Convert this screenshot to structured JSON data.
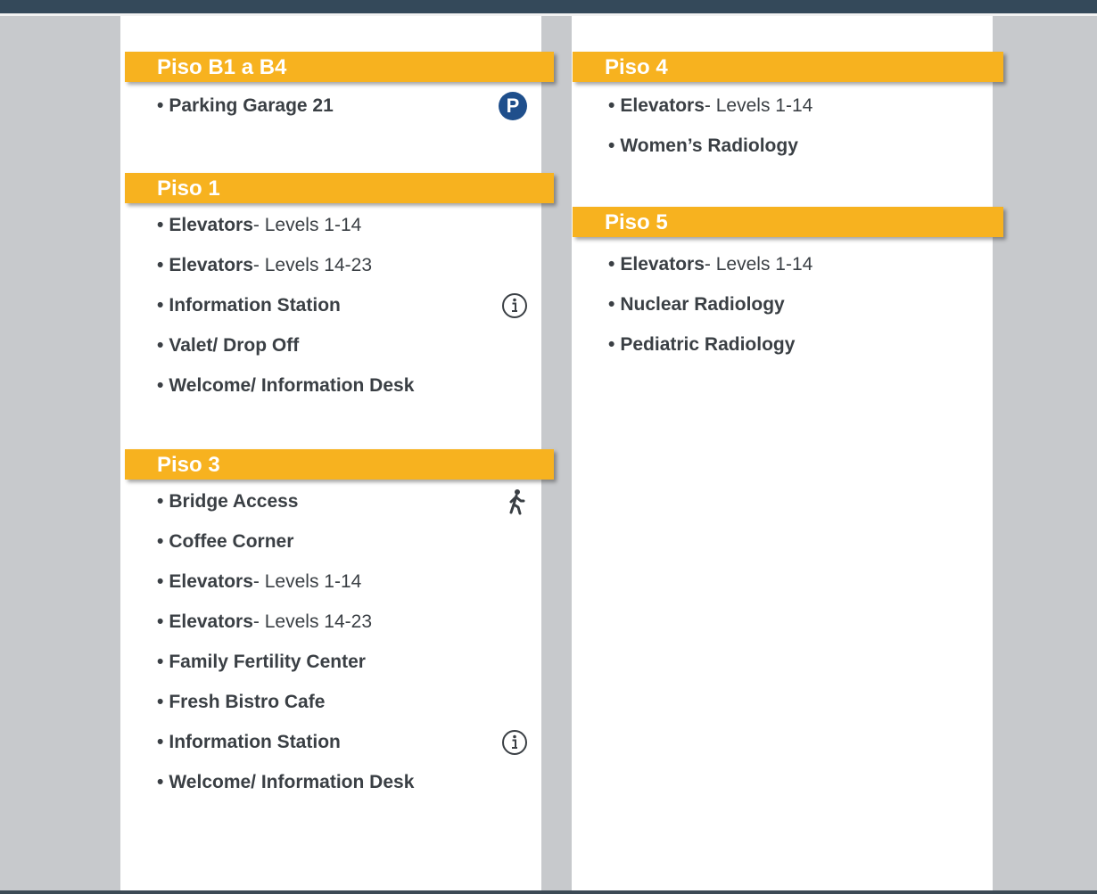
{
  "left_column": [
    {
      "floor": "Piso B1 a B4",
      "items": [
        {
          "name": "Parking Garage 21",
          "detail": "",
          "icon": "parking-icon",
          "icon_text": "P"
        }
      ]
    },
    {
      "floor": "Piso 1",
      "items": [
        {
          "name": "Elevators",
          "detail": "- Levels 1-14",
          "icon": ""
        },
        {
          "name": "Elevators",
          "detail": "- Levels 14-23",
          "icon": ""
        },
        {
          "name": "Information Station",
          "detail": "",
          "icon": "info-icon"
        },
        {
          "name": "Valet/ Drop Off",
          "detail": "",
          "icon": ""
        },
        {
          "name": "Welcome/ Information Desk",
          "detail": "",
          "icon": ""
        }
      ]
    },
    {
      "floor": "Piso 3",
      "items": [
        {
          "name": "Bridge Access",
          "detail": "",
          "icon": "walking-person-icon"
        },
        {
          "name": "Coffee Corner",
          "detail": "",
          "icon": ""
        },
        {
          "name": "Elevators",
          "detail": "- Levels 1-14",
          "icon": ""
        },
        {
          "name": "Elevators",
          "detail": "- Levels 14-23",
          "icon": ""
        },
        {
          "name": "Family Fertility Center",
          "detail": "",
          "icon": ""
        },
        {
          "name": "Fresh Bistro Cafe",
          "detail": "",
          "icon": ""
        },
        {
          "name": "Information Station",
          "detail": "",
          "icon": "info-icon"
        },
        {
          "name": "Welcome/ Information Desk",
          "detail": "",
          "icon": ""
        }
      ]
    }
  ],
  "right_column": [
    {
      "floor": "Piso 4",
      "items": [
        {
          "name": "Elevators",
          "detail": "- Levels 1-14",
          "icon": ""
        },
        {
          "name": "Women’s Radiology",
          "detail": "",
          "icon": ""
        }
      ]
    },
    {
      "floor": "Piso 5",
      "items": [
        {
          "name": "Elevators",
          "detail": "- Levels 1-14",
          "icon": ""
        },
        {
          "name": "Nuclear Radiology",
          "detail": "",
          "icon": ""
        },
        {
          "name": "Pediatric Radiology",
          "detail": "",
          "icon": ""
        }
      ]
    }
  ],
  "colors": {
    "header_bar": "#34495a",
    "floor_header": "#f7b21f",
    "background": "#c7c9cc",
    "panel": "#ffffff",
    "parking_icon": "#1f4f8c"
  }
}
